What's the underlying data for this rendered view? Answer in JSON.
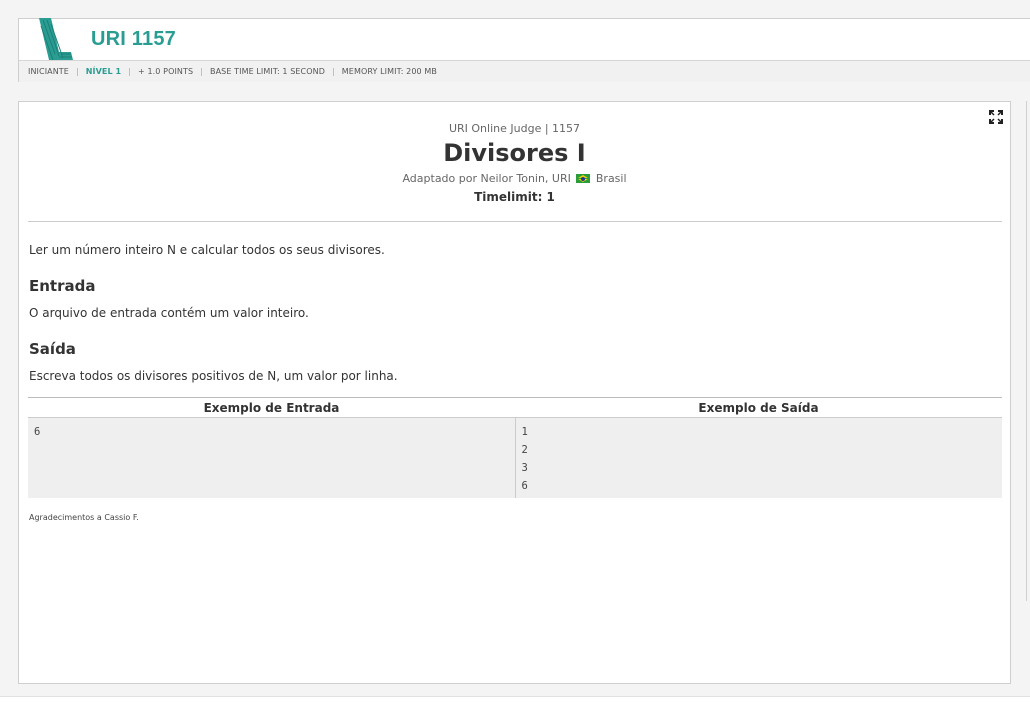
{
  "header": {
    "problem_id": "URI 1157",
    "meta": {
      "category": "INICIANTE",
      "level": "NÍVEL 1",
      "points": "+ 1.0 POINTS",
      "time_limit": "BASE TIME LIMIT: 1 SECOND",
      "memory_limit": "MEMORY LIMIT: 200 MB"
    }
  },
  "problem": {
    "judge_line": "URI Online Judge | 1157",
    "title": "Divisores I",
    "author_prefix": "Adaptado por Neilor Tonin, URI",
    "author_country": "Brasil",
    "timelimit": "Timelimit: 1",
    "description": "Ler um número inteiro N e calcular todos os seus divisores.",
    "input_heading": "Entrada",
    "input_text": "O arquivo de entrada contém um valor inteiro.",
    "output_heading": "Saída",
    "output_text": "Escreva todos os divisores positivos de N, um valor por linha.",
    "samples": {
      "input_header": "Exemplo de Entrada",
      "output_header": "Exemplo de Saída",
      "input": "6",
      "output": "1\n2\n3\n6"
    },
    "thanks": "Agradecimentos a Cassio F."
  },
  "icons": {
    "expand": "expand-icon",
    "flag": "brazil-flag-icon",
    "logo": "uri-logo-icon"
  },
  "colors": {
    "accent": "#2a9d92"
  }
}
